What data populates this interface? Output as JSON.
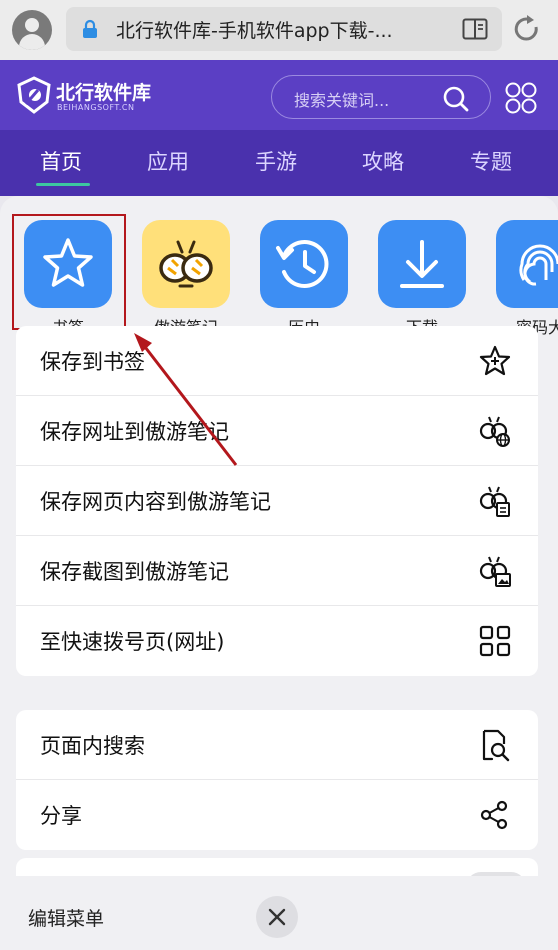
{
  "browser": {
    "url_title": "北行软件库-手机软件app下载-..."
  },
  "site": {
    "logo_text": "北行软件库",
    "logo_sub": "BEIHANGSOFT.CN",
    "search_placeholder": "搜索关键词...",
    "nav": [
      {
        "label": "首页",
        "active": true
      },
      {
        "label": "应用"
      },
      {
        "label": "手游"
      },
      {
        "label": "攻略"
      },
      {
        "label": "专题"
      }
    ]
  },
  "quick_actions": [
    {
      "label": "书签",
      "icon": "star-icon"
    },
    {
      "label": "傲游笔记",
      "icon": "bee-icon"
    },
    {
      "label": "历史",
      "icon": "history-icon"
    },
    {
      "label": "下载",
      "icon": "download-icon"
    },
    {
      "label": "密码大",
      "icon": "fingerprint-icon"
    }
  ],
  "menu_group1": [
    {
      "label": "保存到书签",
      "icon": "star-outline-icon"
    },
    {
      "label": "保存网址到傲游笔记",
      "icon": "bee-globe-icon"
    },
    {
      "label": "保存网页内容到傲游笔记",
      "icon": "bee-document-icon"
    },
    {
      "label": "保存截图到傲游笔记",
      "icon": "bee-image-icon"
    },
    {
      "label": "至快速拨号页(网址)",
      "icon": "grid-icon"
    }
  ],
  "menu_group2": [
    {
      "label": "页面内搜索",
      "icon": "page-search-icon"
    },
    {
      "label": "分享",
      "icon": "share-icon"
    }
  ],
  "bottom": {
    "edit_menu": "编辑菜单"
  },
  "colors": {
    "brand_purple": "#5b3fc4",
    "nav_purple": "#4a31ad",
    "tile_blue": "#3d8ef3",
    "tile_yellow": "#ffe07a",
    "highlight_red": "#b3171c",
    "active_underline": "#3dc7a0"
  }
}
